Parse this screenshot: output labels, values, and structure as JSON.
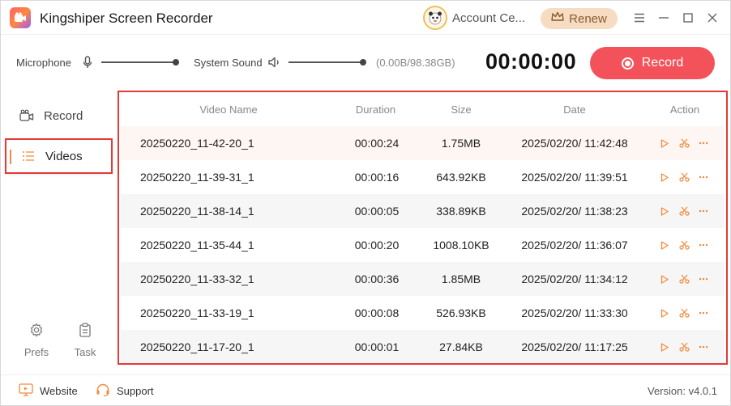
{
  "app": {
    "title": "Kingshiper Screen Recorder",
    "account_label": "Account Ce...",
    "renew_label": "Renew"
  },
  "toolbar": {
    "microphone_label": "Microphone",
    "system_sound_label": "System Sound",
    "microphone_level": 1.0,
    "system_sound_level": 1.0,
    "storage": "(0.00B/98.38GB)",
    "timer": "00:00:00",
    "record_label": "Record"
  },
  "sidebar": {
    "items": [
      {
        "label": "Record",
        "icon": "camera-icon"
      },
      {
        "label": "Videos",
        "icon": "list-icon"
      }
    ],
    "prefs_label": "Prefs",
    "task_label": "Task"
  },
  "table": {
    "headers": {
      "name": "Video Name",
      "duration": "Duration",
      "size": "Size",
      "date": "Date",
      "action": "Action"
    },
    "rows": [
      {
        "name": "20250220_11-42-20_1",
        "duration": "00:00:24",
        "size": "1.75MB",
        "date": "2025/02/20/ 11:42:48"
      },
      {
        "name": "20250220_11-39-31_1",
        "duration": "00:00:16",
        "size": "643.92KB",
        "date": "2025/02/20/ 11:39:51"
      },
      {
        "name": "20250220_11-38-14_1",
        "duration": "00:00:05",
        "size": "338.89KB",
        "date": "2025/02/20/ 11:38:23"
      },
      {
        "name": "20250220_11-35-44_1",
        "duration": "00:00:20",
        "size": "1008.10KB",
        "date": "2025/02/20/ 11:36:07"
      },
      {
        "name": "20250220_11-33-32_1",
        "duration": "00:00:36",
        "size": "1.85MB",
        "date": "2025/02/20/ 11:34:12"
      },
      {
        "name": "20250220_11-33-19_1",
        "duration": "00:00:08",
        "size": "526.93KB",
        "date": "2025/02/20/ 11:33:30"
      },
      {
        "name": "20250220_11-17-20_1",
        "duration": "00:00:01",
        "size": "27.84KB",
        "date": "2025/02/20/ 11:17:25"
      }
    ]
  },
  "footer": {
    "website_label": "Website",
    "support_label": "Support",
    "version": "Version: v4.0.1"
  },
  "colors": {
    "accent": "#f08a3c",
    "record": "#f4525a",
    "highlight": "#e53935"
  }
}
